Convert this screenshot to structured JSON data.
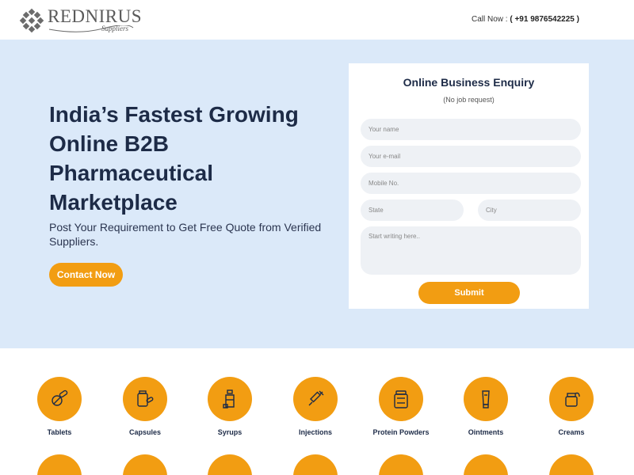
{
  "header": {
    "logo_text": "REDNIRUS",
    "logo_sub": "Suppliers",
    "call_label": "Call Now :",
    "call_number": "( +91 9876542225 )"
  },
  "hero": {
    "title": "India’s Fastest Growing Online B2B Pharmaceutical Marketplace",
    "subtitle": "Post Your Requirement to Get Free Quote from Verified Suppliers.",
    "cta_label": "Contact Now"
  },
  "form": {
    "title": "Online Business Enquiry",
    "note": "(No job request)",
    "name_placeholder": "Your name",
    "email_placeholder": "Your e-mail",
    "mobile_placeholder": "Mobile No.",
    "state_placeholder": "State",
    "city_placeholder": "City",
    "message_placeholder": "Start writing here..",
    "submit_label": "Submit"
  },
  "categories": [
    {
      "label": "Tablets",
      "icon": "tablets-icon"
    },
    {
      "label": "Capsules",
      "icon": "capsules-icon"
    },
    {
      "label": "Syrups",
      "icon": "syrups-icon"
    },
    {
      "label": "Injections",
      "icon": "injections-icon"
    },
    {
      "label": "Protein Powders",
      "icon": "protein-powder-icon"
    },
    {
      "label": "Ointments",
      "icon": "ointment-icon"
    },
    {
      "label": "Creams",
      "icon": "cream-icon"
    }
  ],
  "colors": {
    "accent": "#f29d12",
    "hero_bg": "#dbe9f9",
    "heading": "#1d2b47"
  }
}
